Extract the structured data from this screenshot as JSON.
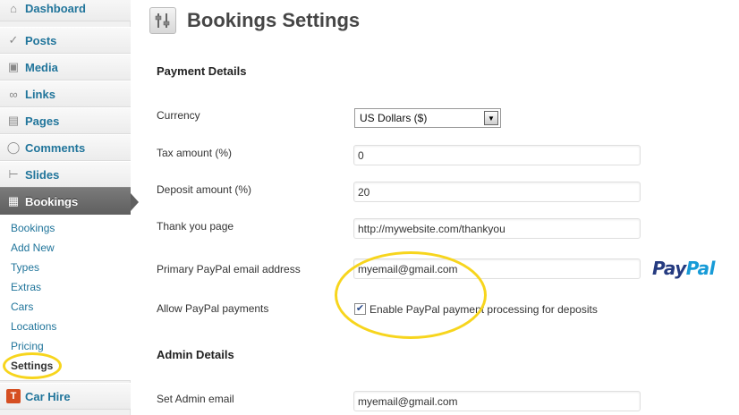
{
  "sidebar": {
    "menu": [
      {
        "label": "Dashboard",
        "icon": "dashboard-icon"
      },
      {
        "label": "Posts",
        "icon": "pin-icon"
      },
      {
        "label": "Media",
        "icon": "media-icon"
      },
      {
        "label": "Links",
        "icon": "link-icon"
      },
      {
        "label": "Pages",
        "icon": "pages-icon"
      },
      {
        "label": "Comments",
        "icon": "comment-icon"
      },
      {
        "label": "Slides",
        "icon": "slides-icon"
      },
      {
        "label": "Bookings",
        "icon": "bookings-icon",
        "current": true
      },
      {
        "label": "Car Hire",
        "icon": "car-hire-icon"
      }
    ],
    "submenu": [
      {
        "label": "Bookings"
      },
      {
        "label": "Add New"
      },
      {
        "label": "Types"
      },
      {
        "label": "Extras"
      },
      {
        "label": "Cars"
      },
      {
        "label": "Locations"
      },
      {
        "label": "Pricing"
      },
      {
        "label": "Settings",
        "current": true
      }
    ]
  },
  "page": {
    "title": "Bookings Settings",
    "icon": "settings-sliders-icon"
  },
  "payment": {
    "section_title": "Payment Details",
    "currency_label": "Currency",
    "currency_value": "US Dollars ($)",
    "tax_label": "Tax amount (%)",
    "tax_value": "0",
    "deposit_label": "Deposit amount (%)",
    "deposit_value": "20",
    "thankyou_label": "Thank you page",
    "thankyou_value": "http://mywebsite.com/thankyou",
    "paypal_email_label": "Primary PayPal email address",
    "paypal_email_value": "myemail@gmail.com",
    "allow_paypal_label": "Allow PayPal payments",
    "allow_paypal_checkbox_label": "Enable PayPal payment processing for deposits",
    "allow_paypal_checked": true,
    "paypal_logo_pay": "Pay",
    "paypal_logo_pal": "Pal"
  },
  "admin": {
    "section_title": "Admin Details",
    "email_label": "Set Admin email",
    "email_value": "myemail@gmail.com"
  },
  "colors": {
    "highlight": "#f7d51d",
    "link": "#21759b",
    "current_menu_bg": "#6b6b6b"
  }
}
